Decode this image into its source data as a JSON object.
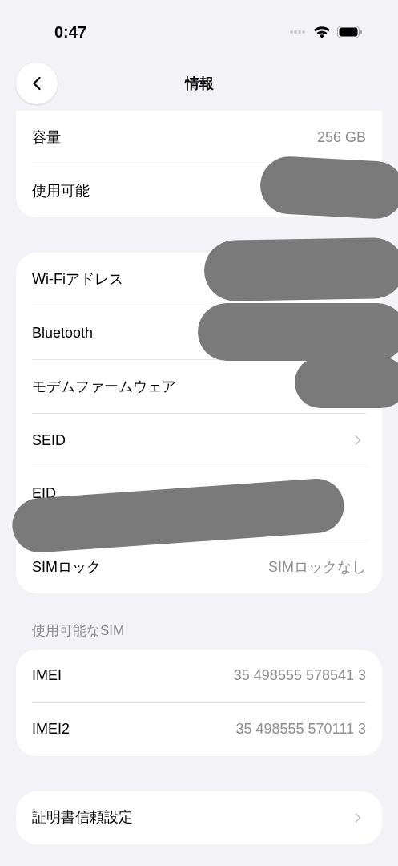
{
  "status_bar": {
    "time": "0:47"
  },
  "nav": {
    "title": "情報"
  },
  "groups": [
    {
      "rows": [
        {
          "label": "容量",
          "value": "256 GB"
        },
        {
          "label": "使用可能"
        }
      ]
    },
    {
      "rows": [
        {
          "label": "Wi-Fiアドレス"
        },
        {
          "label": "Bluetooth"
        },
        {
          "label": "モデムファームウェア"
        },
        {
          "label": "SEID",
          "chevron": true
        },
        {
          "label": "EID",
          "kind": "tall"
        },
        {
          "label": "SIMロック",
          "value": "SIMロックなし"
        }
      ]
    },
    {
      "header": "使用可能なSIM",
      "rows": [
        {
          "label": "IMEI",
          "value": "35 498555 578541 3"
        },
        {
          "label": "IMEI2",
          "value": "35 498555 570111 3"
        }
      ]
    },
    {
      "rows": [
        {
          "label": "証明書信頼設定",
          "chevron": true
        }
      ]
    }
  ]
}
